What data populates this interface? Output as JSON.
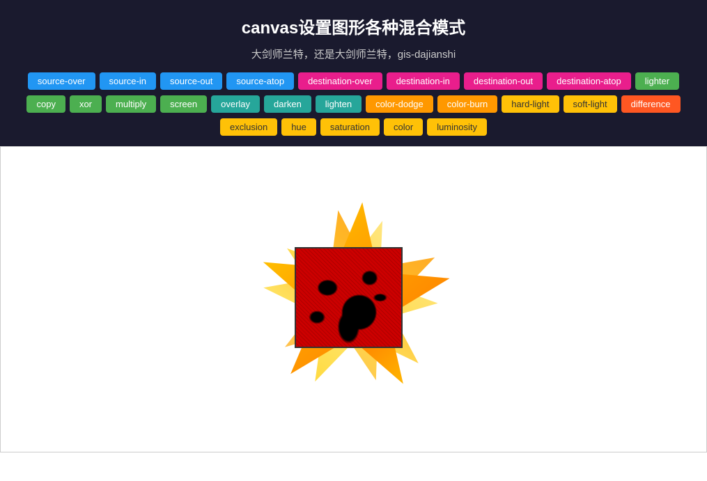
{
  "header": {
    "title": "canvas设置图形各种混合模式",
    "subtitle": "大剑师兰特，还是大剑师兰特，gis-dajianshi"
  },
  "buttons": {
    "row1": [
      {
        "label": "source-over",
        "style": "btn-blue",
        "active": true
      },
      {
        "label": "source-in",
        "style": "btn-blue"
      },
      {
        "label": "source-out",
        "style": "btn-blue"
      },
      {
        "label": "source-atop",
        "style": "btn-blue"
      },
      {
        "label": "destination-over",
        "style": "btn-pink"
      },
      {
        "label": "destination-in",
        "style": "btn-pink"
      },
      {
        "label": "destination-out",
        "style": "btn-pink"
      },
      {
        "label": "destination-atop",
        "style": "btn-pink"
      },
      {
        "label": "lighter",
        "style": "btn-green"
      }
    ],
    "row2": [
      {
        "label": "copy",
        "style": "btn-green"
      },
      {
        "label": "xor",
        "style": "btn-green"
      },
      {
        "label": "multiply",
        "style": "btn-green"
      },
      {
        "label": "screen",
        "style": "btn-green"
      },
      {
        "label": "overlay",
        "style": "btn-teal"
      },
      {
        "label": "darken",
        "style": "btn-teal"
      },
      {
        "label": "lighten",
        "style": "btn-teal"
      },
      {
        "label": "color-dodge",
        "style": "btn-orange"
      },
      {
        "label": "color-burn",
        "style": "btn-orange"
      },
      {
        "label": "hard-light",
        "style": "btn-amber"
      },
      {
        "label": "soft-light",
        "style": "btn-amber"
      },
      {
        "label": "difference",
        "style": "btn-deep-orange"
      }
    ],
    "row3": [
      {
        "label": "exclusion",
        "style": "btn-amber"
      },
      {
        "label": "hue",
        "style": "btn-amber"
      },
      {
        "label": "saturation",
        "style": "btn-amber"
      },
      {
        "label": "color",
        "style": "btn-amber"
      },
      {
        "label": "luminosity",
        "style": "btn-amber"
      }
    ]
  }
}
